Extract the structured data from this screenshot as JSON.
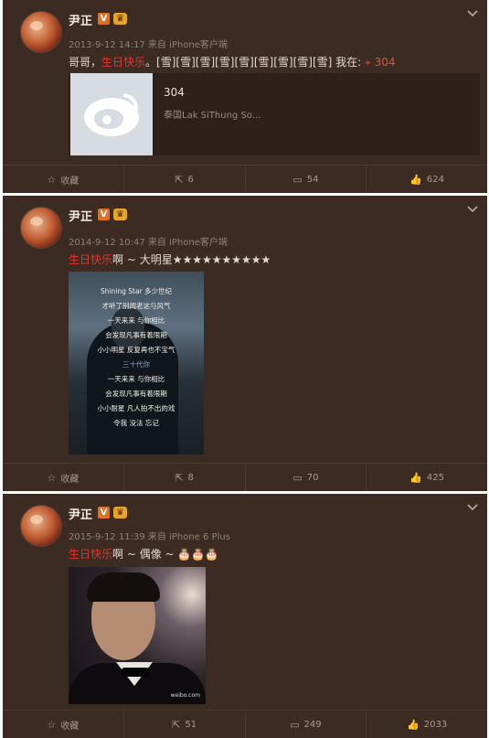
{
  "user": {
    "name": "尹正",
    "v_badge": "V"
  },
  "posts": [
    {
      "meta": "2013-9-12 14:17 来自 iPhone客户端",
      "text_prefix": "哥哥，",
      "text_red": "生日快乐",
      "text_suffix": "。[雪][雪][雪][雪][雪][雪][雪][雪][雪] 我在: ",
      "location": "304",
      "card": {
        "title": "304",
        "subtitle": "泰国Lak SiThung So..."
      },
      "actions": {
        "favorite": "收藏",
        "repost": "6",
        "comment": "54",
        "like": "624"
      }
    },
    {
      "meta": "2014-9-12 10:47 来自 iPhone客户端",
      "text_red": "生日快乐",
      "text_suffix": "啊 ~ 大明星★★★★★★★★★★",
      "photo_lines": [
        "Shining Star 多少世纪",
        "才听了别闻老这与风气",
        "一天来来 与你相比",
        "会发现凡事有着限期",
        "小小明星 反复再也不宝气",
        "三十代你",
        "一天来来 与你相比",
        "会发现凡事有着限期",
        "小小耐星 凡人拍不出的戏",
        "令我 没法 忘记"
      ],
      "actions": {
        "favorite": "收藏",
        "repost": "8",
        "comment": "70",
        "like": "425"
      }
    },
    {
      "meta": "2015-9-12 11:39 来自 iPhone 6 Plus",
      "text_red": "生日快乐",
      "text_suffix": "啊 ~ 偶像 ~ ",
      "photo_watermark": "weibo.com",
      "actions": {
        "favorite": "收藏",
        "repost": "51",
        "comment": "249",
        "like": "2033"
      }
    }
  ],
  "icons": {
    "favorite": "star-outline-icon",
    "repost": "repost-icon",
    "comment": "comment-icon",
    "like": "thumbs-up-icon",
    "menu": "chevron-down-icon"
  },
  "colors": {
    "background": "#3b2b22",
    "highlight": "#e6342c",
    "location": "#d9573d",
    "vip": "#e0701f"
  }
}
